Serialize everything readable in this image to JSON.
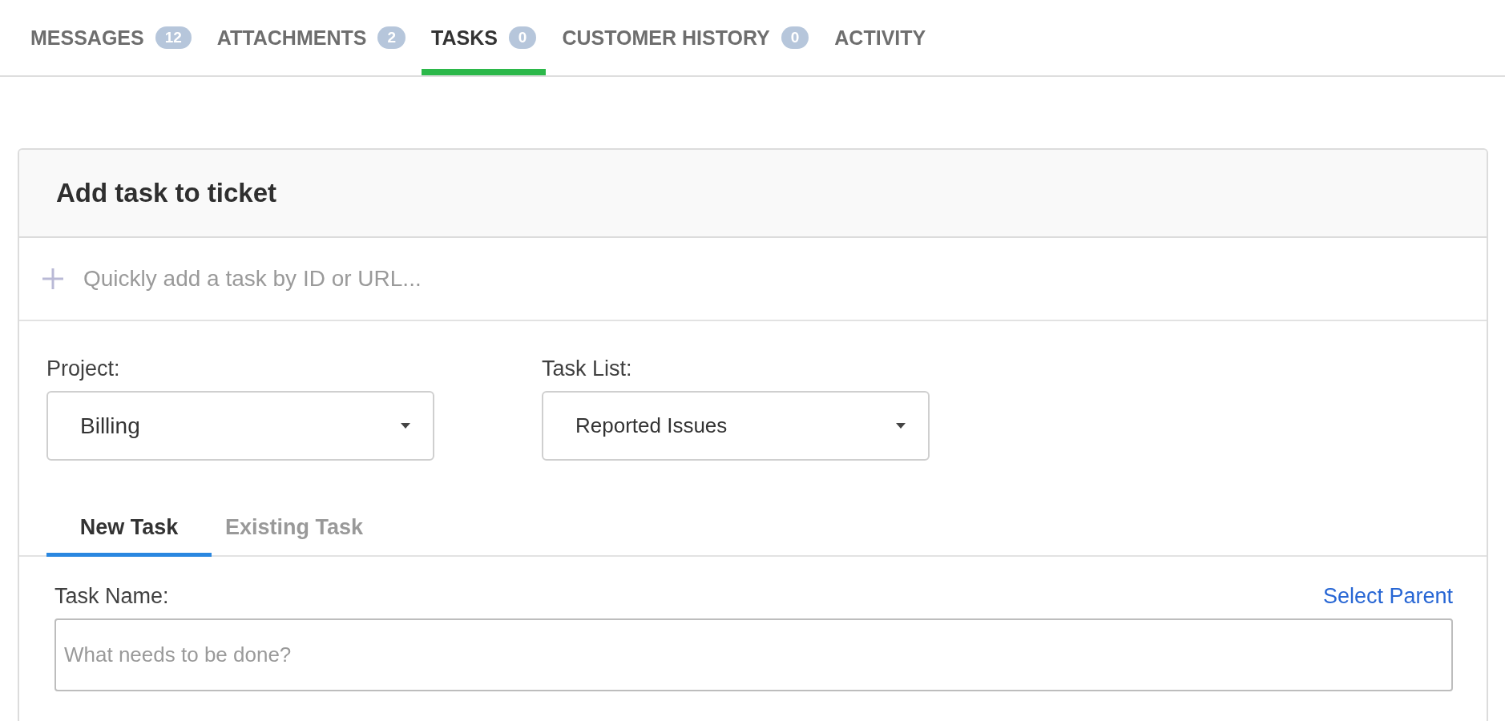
{
  "tabs": [
    {
      "label": "MESSAGES",
      "count": "12",
      "selected": false
    },
    {
      "label": "ATTACHMENTS",
      "count": "2",
      "selected": false
    },
    {
      "label": "TASKS",
      "count": "0",
      "selected": true
    },
    {
      "label": "CUSTOMER HISTORY",
      "count": "0",
      "selected": false
    },
    {
      "label": "ACTIVITY",
      "selected": false
    }
  ],
  "card": {
    "title": "Add task to ticket",
    "quick_add": {
      "placeholder": "Quickly add a task by ID or URL..."
    },
    "project": {
      "label": "Project:",
      "value": "Billing"
    },
    "task_list": {
      "label": "Task List:",
      "value": "Reported Issues"
    },
    "subtabs": [
      {
        "label": "New Task",
        "selected": true
      },
      {
        "label": "Existing Task",
        "selected": false
      }
    ],
    "task_name": {
      "label": "Task Name:",
      "link": "Select Parent",
      "placeholder": "What needs to be done?"
    }
  }
}
